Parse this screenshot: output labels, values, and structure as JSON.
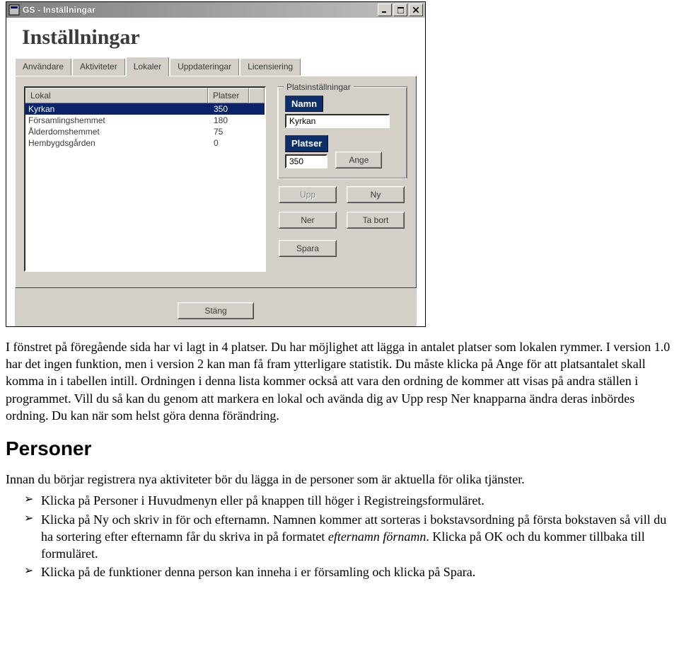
{
  "window": {
    "title": "GS - Inställningar",
    "icon": "app-icon",
    "heading": "Inställningar",
    "tabs": [
      "Användare",
      "Aktiviteter",
      "Lokaler",
      "Uppdateringar",
      "Licensiering"
    ],
    "active_tab_index": 2,
    "list": {
      "columns": [
        "Lokal",
        "Platser"
      ],
      "rows": [
        {
          "lokal": "Kyrkan",
          "platser": "350",
          "selected": true
        },
        {
          "lokal": "Församlingshemmet",
          "platser": "180",
          "selected": false
        },
        {
          "lokal": "Ålderdomshemmet",
          "platser": "75",
          "selected": false
        },
        {
          "lokal": "Hembygdsgården",
          "platser": "0",
          "selected": false
        }
      ]
    },
    "group": {
      "legend": "Platsinställningar",
      "namn_label": "Namn",
      "namn_value": "Kyrkan",
      "platser_label": "Platser",
      "platser_value": "350",
      "ange_label": "Ange"
    },
    "buttons": {
      "upp": "Upp",
      "ny": "Ny",
      "ner": "Ner",
      "tabort": "Ta bort",
      "spara": "Spara",
      "stang": "Stäng"
    }
  },
  "article": {
    "p1": "I fönstret på föregående sida har vi lagt in 4 platser. Du har möjlighet att lägga in antalet platser som lokalen rymmer. I version 1.0 har det ingen funktion, men i version 2 kan man få fram ytterligare statistik. Du måste klicka på Ange för att platsantalet skall komma in i tabellen intill. Ordningen i denna lista kommer också att vara den ordning de kommer att visas på andra ställen i programmet. Vill du så kan du genom att markera en lokal och avända dig av Upp resp Ner knapparna ändra deras inbördes ordning. Du kan när som helst göra denna förändring.",
    "h2": "Personer",
    "p2": "Innan du börjar registrera nya aktiviteter bör du lägga in de personer som är aktuella för olika tjänster.",
    "b1": "Klicka på Personer i Huvudmenyn eller på knappen till höger i Registreingsformuläret.",
    "b2_a": "Klicka på Ny och skriv in för och efternamn. Namnen kommer att sorteras i bokstavsordning på första bokstaven så vill du ha sortering efter efternamn får du skriva in på formatet ",
    "b2_i": "efternamn förnamn",
    "b2_b": ". Klicka på OK och du kommer tillbaka till formuläret.",
    "b3": "Klicka på de funktioner denna person kan inneha i er församling och klicka på Spara."
  }
}
